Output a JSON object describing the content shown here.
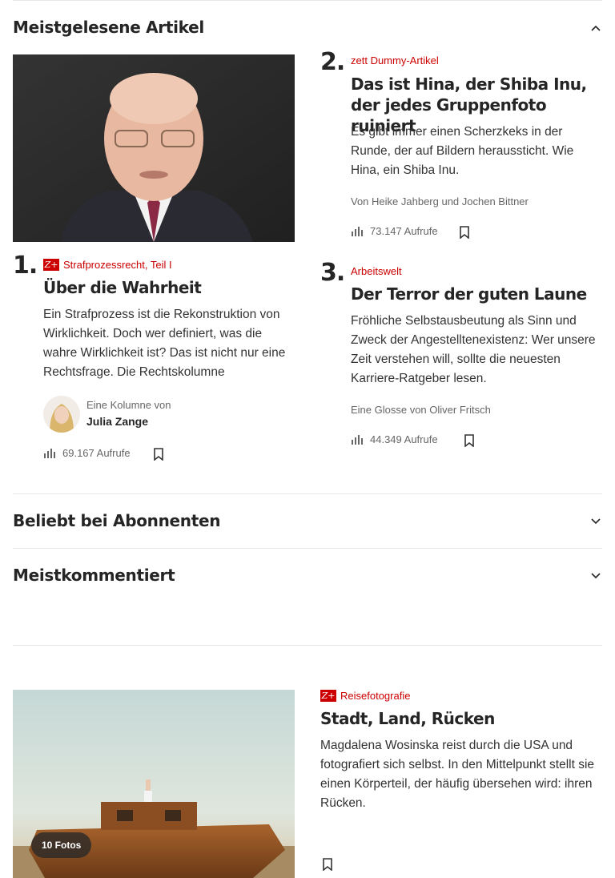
{
  "sections": {
    "most_read": {
      "title": "Meistgelesene Artikel"
    },
    "subscribers": {
      "title": "Beliebt bei Abonnenten"
    },
    "most_commented": {
      "title": "Meistkommentiert"
    }
  },
  "articles": [
    {
      "rank": "1.",
      "zplus": true,
      "kicker": "Strafprozessrecht, Teil I",
      "title": "Über die Wahrheit",
      "teaser": "Ein Strafprozess ist die Rekonstruktion von Wirklichkeit. Doch wer definiert, was die wahre Wirklichkeit ist? Das ist nicht nur eine Rechtsfrage. Die Rechtskolumne",
      "author_label": "Eine Kolumne von",
      "author_name": "Julia Zange",
      "views": "69.167 Aufrufe"
    },
    {
      "rank": "2.",
      "zplus": false,
      "kicker": "zett Dummy-Artikel",
      "title": "Das ist Hina, der Shiba Inu, der jedes Gruppenfoto ruiniert",
      "teaser": "Es gibt immer einen Scherzkeks in der Runde, der auf Bildern heraussticht. Wie Hina, ein Shiba Inu.",
      "byline": "Von Heike Jahberg und Jochen Bittner",
      "views": "73.147 Aufrufe"
    },
    {
      "rank": "3.",
      "zplus": false,
      "kicker": "Arbeitswelt",
      "title": "Der Terror der guten Laune",
      "teaser": "Fröhliche Selbstausbeutung als Sinn und Zweck der Angestelltenexistenz: Wer unsere Zeit verstehen will, sollte die neuesten Karriere-Ratgeber lesen.",
      "byline": "Eine Glosse von Oliver Fritsch",
      "views": "44.349 Aufrufe"
    }
  ],
  "feature": {
    "zplus": true,
    "kicker": "Reisefotografie",
    "title": "Stadt, Land, Rücken",
    "teaser": "Magdalena Wosinska reist durch die USA und fotografiert sich selbst. In den Mittelpunkt stellt sie einen Körperteil, der häufig übersehen wird: ihren Rücken.",
    "photo_count": "10 Fotos"
  },
  "icons": {
    "chevron_up": "chevron-up-icon",
    "chevron_down": "chevron-down-icon",
    "bookmark": "bookmark-icon",
    "views": "bar-chart-icon",
    "zplus": "z-plus-icon"
  },
  "colors": {
    "accent": "#cc0000",
    "text": "#252525",
    "meta": "#666666",
    "divider": "#e6e6e6"
  }
}
